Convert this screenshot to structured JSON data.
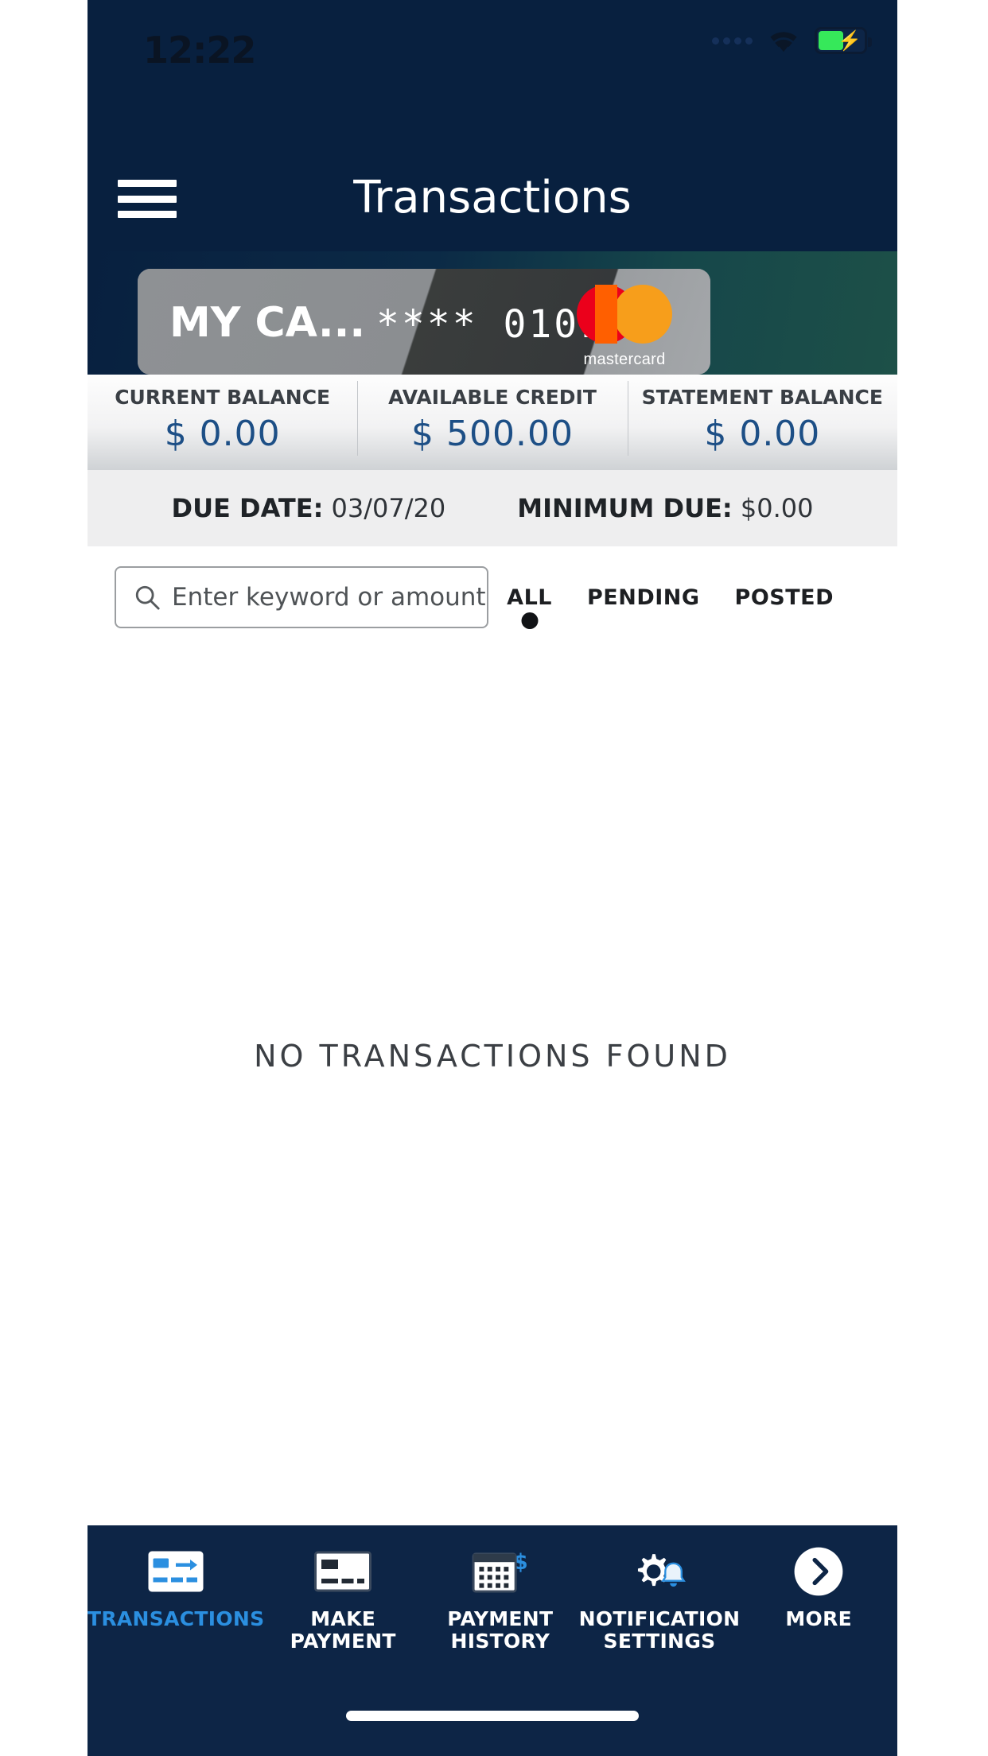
{
  "status_bar": {
    "time": "12:22",
    "icons": [
      "signal-dots-icon",
      "wifi-icon",
      "battery-charging-icon"
    ],
    "battery_charging": true
  },
  "header": {
    "menu_icon": "hamburger-menu-icon",
    "title": "Transactions"
  },
  "card": {
    "name": "MY CA...",
    "masked_number": "**** 0101",
    "network": "mastercard",
    "network_label": "mastercard"
  },
  "balances": [
    {
      "label": "CURRENT BALANCE",
      "value": "$ 0.00"
    },
    {
      "label": "AVAILABLE CREDIT",
      "value": "$ 500.00"
    },
    {
      "label": "STATEMENT BALANCE",
      "value": "$ 0.00"
    }
  ],
  "due_row": {
    "due_date_label": "DUE DATE:",
    "due_date_value": "03/07/20",
    "minimum_due_label": "MINIMUM DUE:",
    "minimum_due_value": "$0.00"
  },
  "search": {
    "placeholder": "Enter keyword or amount",
    "value": "",
    "icon": "search-icon"
  },
  "filters": [
    {
      "label": "ALL",
      "selected": true
    },
    {
      "label": "PENDING",
      "selected": false
    },
    {
      "label": "POSTED",
      "selected": false
    }
  ],
  "empty_state": {
    "message": "NO TRANSACTIONS FOUND"
  },
  "tabbar": [
    {
      "label": "TRANSACTIONS",
      "icon": "card-transfer-icon",
      "active": true
    },
    {
      "label": "MAKE PAYMENT",
      "icon": "card-icon",
      "active": false
    },
    {
      "label": "PAYMENT HISTORY",
      "icon": "calendar-dollar-icon",
      "active": false
    },
    {
      "label": "NOTIFICATION SETTINGS",
      "icon": "gear-bell-icon",
      "active": false
    },
    {
      "label": "MORE",
      "icon": "chevron-right-circle-icon",
      "active": false
    }
  ],
  "colors": {
    "navy": "#08203f",
    "tabbar_navy": "#0d2546",
    "accent_blue": "#2b8fe0",
    "balance_value": "#1d4f86",
    "battery_green": "#36e85a",
    "mastercard_red": "#eb001b",
    "mastercard_orange": "#f79e1b"
  }
}
